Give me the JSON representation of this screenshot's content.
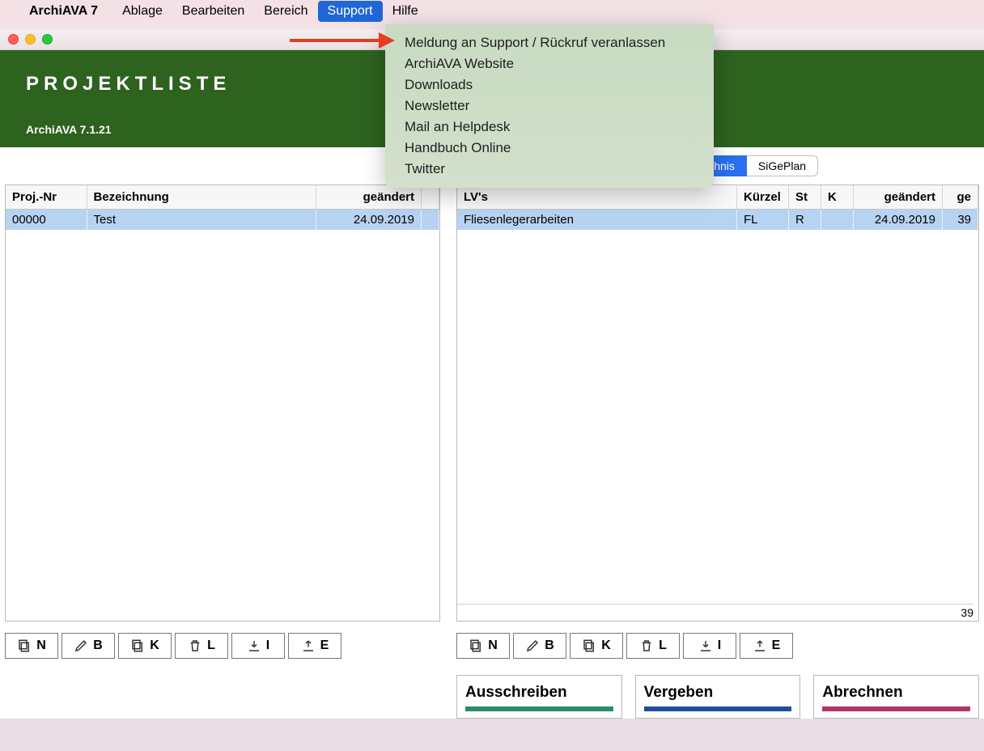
{
  "menubar": {
    "app_name": "ArchiAVA 7",
    "items": [
      "Ablage",
      "Bearbeiten",
      "Bereich",
      "Support",
      "Hilfe"
    ],
    "active_index": 3
  },
  "dropdown": {
    "items": [
      "Meldung an Support / Rückruf veranlassen",
      "ArchiAVA Website",
      "Downloads",
      "Newsletter",
      "Mail an Helpdesk",
      "Handbuch Online",
      "Twitter"
    ]
  },
  "header": {
    "title": "PROJEKTLISTE",
    "version": "ArchiAVA 7.1.21"
  },
  "tabs": {
    "items": [
      "Leistungsverzeichnis",
      "SiGePlan"
    ],
    "active_index": 0
  },
  "left_table": {
    "columns": [
      "Proj.-Nr",
      "Bezeichnung",
      "geändert",
      ""
    ],
    "rows": [
      {
        "nr": "00000",
        "bez": "Test",
        "date": "24.09.2019"
      }
    ]
  },
  "right_table": {
    "columns": [
      "LV's",
      "Kürzel",
      "St",
      "K",
      "geändert",
      "ge"
    ],
    "rows": [
      {
        "lv": "Fliesenlegerarbeiten",
        "kz": "FL",
        "st": "R",
        "k": "",
        "date": "24.09.2019",
        "ge": "39"
      }
    ],
    "footer_count": "39"
  },
  "toolbar": {
    "n": "N",
    "b": "B",
    "k": "K",
    "l": "L",
    "i": "I",
    "e": "E"
  },
  "actions": {
    "a1": "Ausschreiben",
    "a2": "Vergeben",
    "a3": "Abrechnen"
  }
}
